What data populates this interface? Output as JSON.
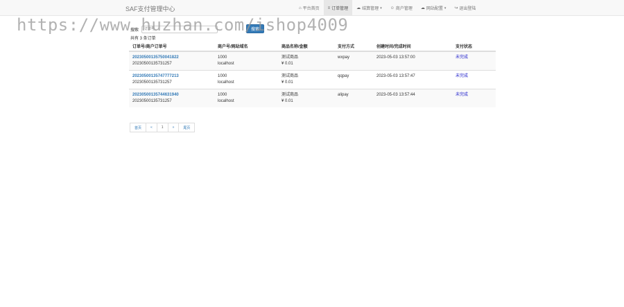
{
  "navbar": {
    "brand": "SAF支付管理中心",
    "items": [
      {
        "icon": "home-icon",
        "glyph": "⌂",
        "label": "平台首页",
        "active": false,
        "caret": false
      },
      {
        "icon": "cart-icon",
        "glyph": "≡",
        "label": "订单管理",
        "active": true,
        "caret": false
      },
      {
        "icon": "cloud-icon",
        "glyph": "☁",
        "label": "结算管理",
        "active": false,
        "caret": true
      },
      {
        "icon": "user-icon",
        "glyph": "☺",
        "label": "商户管理",
        "active": false,
        "caret": false
      },
      {
        "icon": "cloud-icon",
        "glyph": "☁",
        "label": "网站配置",
        "active": false,
        "caret": true
      },
      {
        "icon": "logout-icon",
        "glyph": "↪",
        "label": "退出登陆",
        "active": false,
        "caret": false
      }
    ]
  },
  "watermark": "https://www.huzhan.com/ishop4009",
  "search": {
    "label": "搜索",
    "placeholder": "订单号",
    "button": "搜索"
  },
  "summary": "共有 3 条订单",
  "table": {
    "headers": [
      "订单号/商户订单号",
      "商户号/网站域名",
      "商品名称/金额",
      "支付方式",
      "创建时间/完成时间",
      "支付状态"
    ],
    "rows": [
      {
        "order_no": "20230500135750041822",
        "merchant_order_no": "20230500135731257",
        "merchant_id": "1000",
        "domain": "localhost",
        "product": "测试商品",
        "amount": "¥ 0.01",
        "method": "wxpay",
        "created": "2023-05-03 13:57:00",
        "status": "未完成"
      },
      {
        "order_no": "20230500135747777213",
        "merchant_order_no": "20230500135731257",
        "merchant_id": "1000",
        "domain": "localhost",
        "product": "测试商品",
        "amount": "¥ 0.01",
        "method": "qqpay",
        "created": "2023-05-03 13:57:47",
        "status": "未完成"
      },
      {
        "order_no": "20230500135744631940",
        "merchant_order_no": "20230500135731257",
        "merchant_id": "1000",
        "domain": "localhost",
        "product": "测试商品",
        "amount": "¥ 0.01",
        "method": "alipay",
        "created": "2023-05-03 13:57:44",
        "status": "未完成"
      }
    ]
  },
  "pagination": {
    "first": "首页",
    "prev": "«",
    "current": "1",
    "next": "»",
    "last": "尾页"
  }
}
